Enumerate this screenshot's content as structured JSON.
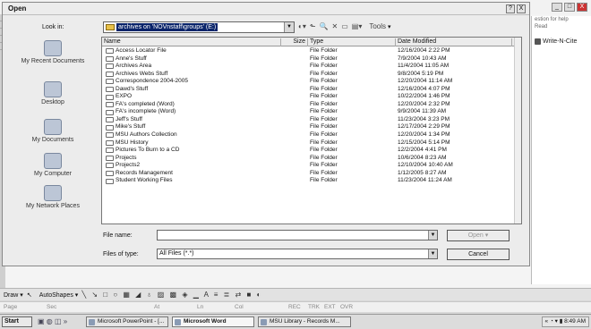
{
  "dialog": {
    "title": "Open",
    "controls": [
      "?",
      "X"
    ],
    "look_in_label": "Look in:",
    "look_in_value": "archives on 'NOVnstaff\\groups' (E:)",
    "tools_label": "Tools",
    "places": [
      "My Recent Documents",
      "Desktop",
      "My Documents",
      "My Computer",
      "My Network Places"
    ],
    "columns": {
      "name": "Name",
      "size": "Size",
      "type": "Type",
      "date": "Date Modified"
    },
    "files": [
      {
        "name": "Access Locator File",
        "type": "File Folder",
        "date": "12/16/2004 2:22 PM"
      },
      {
        "name": "Anne's Stuff",
        "type": "File Folder",
        "date": "7/9/2004 10:43 AM"
      },
      {
        "name": "Archives Area",
        "type": "File Folder",
        "date": "11/4/2004 11:05 AM"
      },
      {
        "name": "Archives Webs Stuff",
        "type": "File Folder",
        "date": "9/8/2004 5:19 PM"
      },
      {
        "name": "Correspondence 2004-2005",
        "type": "File Folder",
        "date": "12/20/2004 11:14 AM"
      },
      {
        "name": "Dawd's Stuff",
        "type": "File Folder",
        "date": "12/16/2004 4:07 PM"
      },
      {
        "name": "EXPO",
        "type": "File Folder",
        "date": "10/22/2004 1:46 PM"
      },
      {
        "name": "FA's completed (Word)",
        "type": "File Folder",
        "date": "12/20/2004 2:32 PM"
      },
      {
        "name": "FA's incomplete (Word)",
        "type": "File Folder",
        "date": "9/9/2004 11:39 AM"
      },
      {
        "name": "Jeff's Stuff",
        "type": "File Folder",
        "date": "11/23/2004 3:23 PM"
      },
      {
        "name": "Mike's Stuff",
        "type": "File Folder",
        "date": "12/17/2004 2:29 PM"
      },
      {
        "name": "MSU Authors Collection",
        "type": "File Folder",
        "date": "12/20/2004 1:34 PM"
      },
      {
        "name": "MSU History",
        "type": "File Folder",
        "date": "12/15/2004 5:14 PM"
      },
      {
        "name": "Pictures To Burn to a CD",
        "type": "File Folder",
        "date": "12/2/2004 4:41 PM"
      },
      {
        "name": "Projects",
        "type": "File Folder",
        "date": "10/6/2004 8:23 AM"
      },
      {
        "name": "Projects2",
        "type": "File Folder",
        "date": "12/10/2004 10:40 AM"
      },
      {
        "name": "Records Management",
        "type": "File Folder",
        "date": "1/12/2005 8:27 AM"
      },
      {
        "name": "Student Working Files",
        "type": "File Folder",
        "date": "11/23/2004 11:24 AM"
      }
    ],
    "file_name_label": "File name:",
    "file_name_value": "",
    "file_type_label": "Files of type:",
    "file_type_value": "All Files (*.*)",
    "open_label": "Open",
    "cancel_label": "Cancel"
  },
  "word": {
    "side_pane": [
      "estion for help",
      "Read",
      "Write-N-Cite"
    ],
    "window_controls": [
      "_",
      "□",
      "X"
    ]
  },
  "drawbar": {
    "draw_label": "Draw",
    "autoshapes_label": "AutoShapes"
  },
  "statusbar": [
    "Page",
    "Sec",
    "At",
    "Ln",
    "Col",
    "REC",
    "TRK",
    "EXT",
    "OVR"
  ],
  "taskbar": {
    "start_label": "Start",
    "tasks": [
      "Microsoft PowerPoint - [...",
      "Microsoft Word",
      "MSU Library - Records M..."
    ],
    "clock": "8:49 AM"
  }
}
